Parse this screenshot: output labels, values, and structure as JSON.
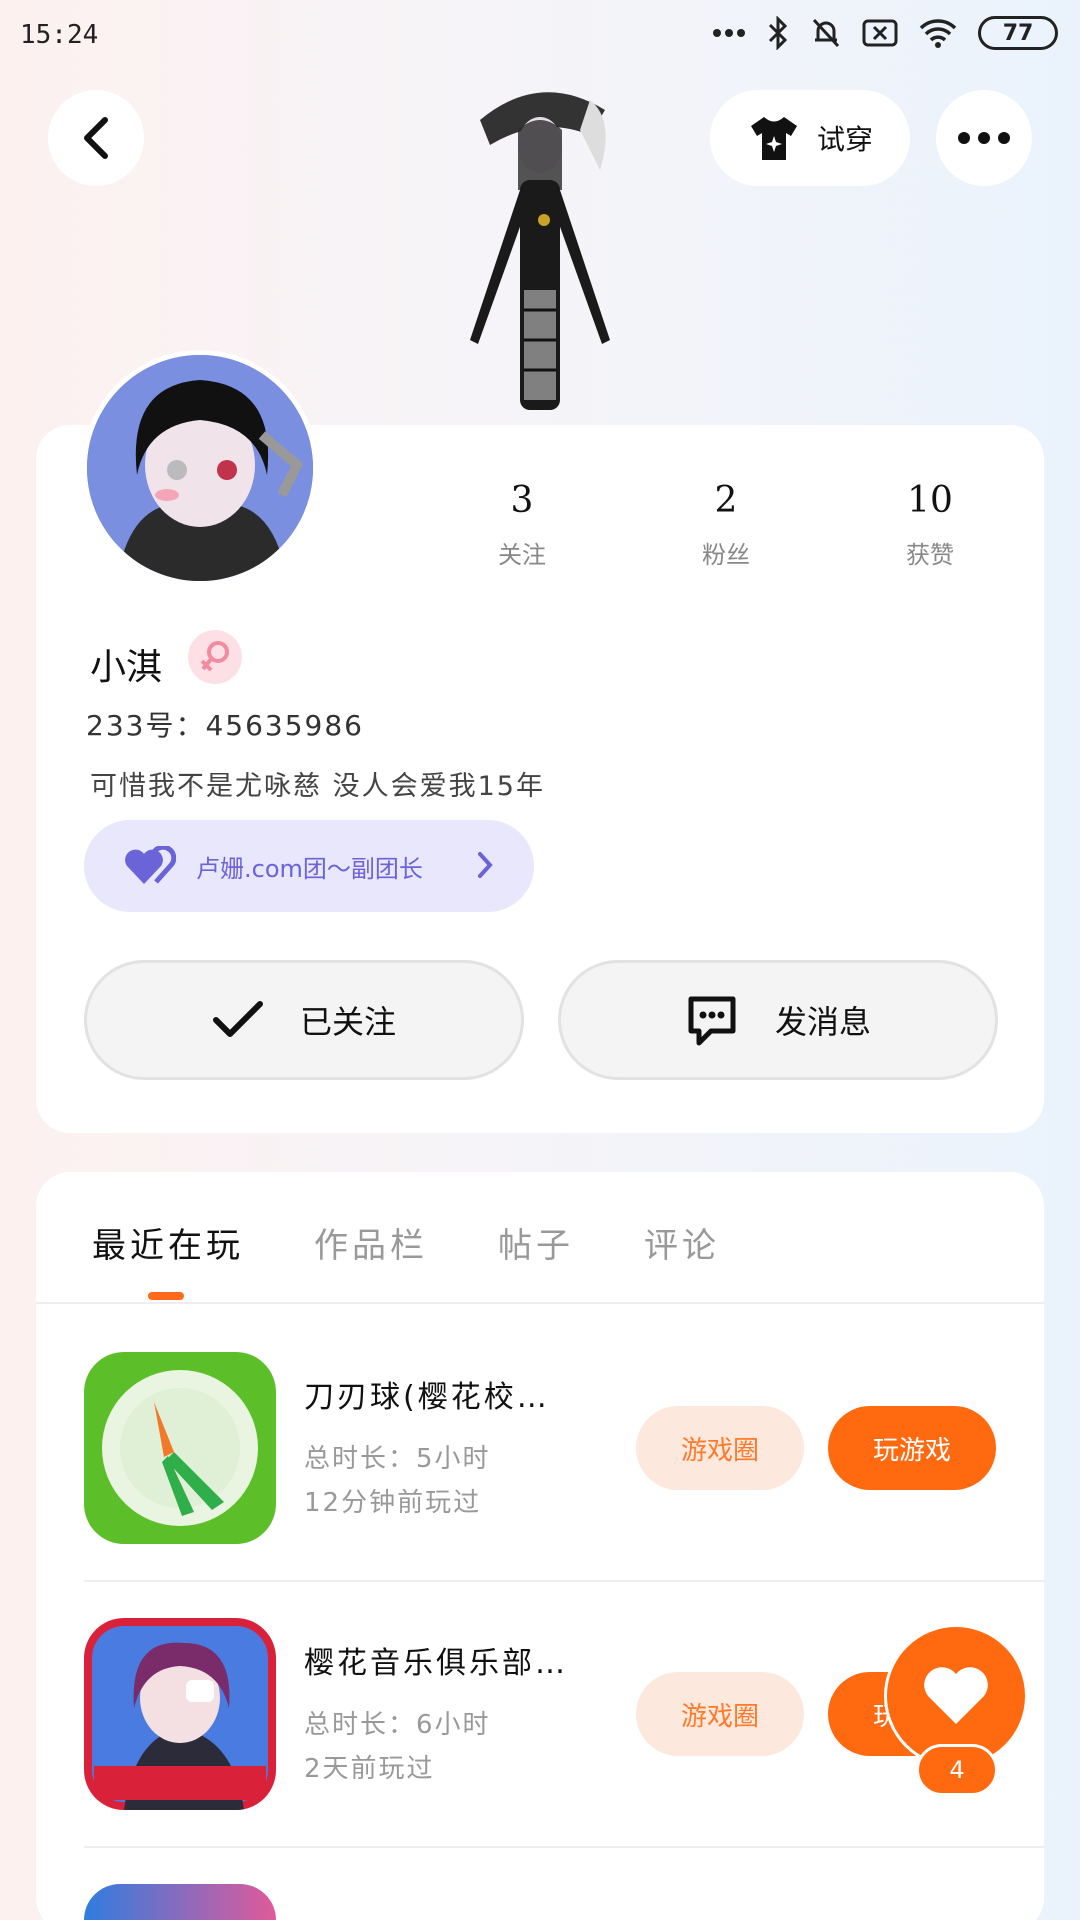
{
  "status_bar": {
    "time": "15:24",
    "battery": "77",
    "icons": [
      "more-dots-icon",
      "bluetooth-icon",
      "mute-bell-icon",
      "close-box-icon",
      "wifi-icon",
      "battery-icon"
    ]
  },
  "header": {
    "back_icon": "chevron-left-icon",
    "tryon_label": "试穿",
    "more_icon": "more-dots-icon"
  },
  "profile": {
    "stats": [
      {
        "value": "3",
        "label": "关注"
      },
      {
        "value": "2",
        "label": "粉丝"
      },
      {
        "value": "10",
        "label": "获赞"
      }
    ],
    "name": "小淇",
    "gender_icon": "female-icon",
    "uid": "233号：45635986",
    "bio": "可惜我不是尤咏慈 没人会爱我15年",
    "group": "卢姗.com团～副团长",
    "follow_label": "已关注",
    "message_label": "发消息"
  },
  "colors": {
    "accent": "#ff6a10",
    "accent_light": "#fde8de",
    "group_bg": "#e8e7fb",
    "group_text": "#6b63d8",
    "female": "#f28aa0"
  },
  "tabs": [
    {
      "label": "最近在玩",
      "active": true
    },
    {
      "label": "作品栏",
      "active": false
    },
    {
      "label": "帖子",
      "active": false
    },
    {
      "label": "评论",
      "active": false
    }
  ],
  "games": [
    {
      "title": "刀刃球(樱花校…",
      "duration": "总时长：5小时",
      "last_played": "12分钟前玩过",
      "circle_label": "游戏圈",
      "play_label": "玩游戏"
    },
    {
      "title": "樱花音乐俱乐部…",
      "duration": "总时长：6小时",
      "last_played": "2天前玩过",
      "circle_label": "游戏圈",
      "play_label": "玩游戏"
    }
  ],
  "fab": {
    "count": "4",
    "icon": "heart-icon"
  }
}
